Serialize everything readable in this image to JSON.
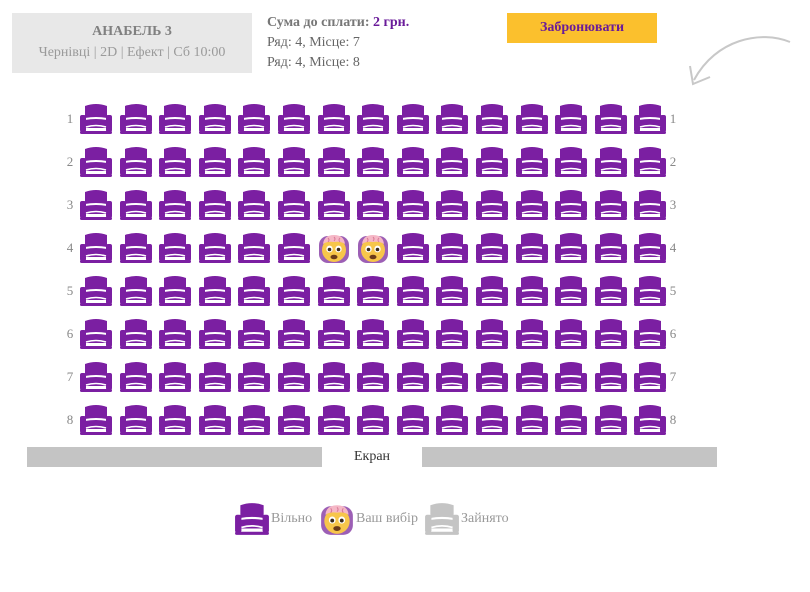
{
  "movie": {
    "title": "АНАБЕЛЬ 3",
    "details": "Чернівці | 2D | Ефект | Сб 10:00"
  },
  "order": {
    "total_label": "Сума до сплати:",
    "total_amount": "2 грн.",
    "tickets": [
      "Ряд: 4, Місце: 7",
      "Ряд: 4, Місце: 8"
    ]
  },
  "book_button": {
    "label": "Забронювати"
  },
  "hall": {
    "rows": [
      "1",
      "2",
      "3",
      "4",
      "5",
      "6",
      "7",
      "8"
    ],
    "seats_per_row": 15,
    "selected": [
      {
        "row": 4,
        "seat": 7
      },
      {
        "row": 4,
        "seat": 8
      }
    ],
    "occupied": []
  },
  "screen": {
    "label": "Екран"
  },
  "legend": {
    "free": "Вільно",
    "selected": "Ваш вибір",
    "occupied": "Зайнято"
  },
  "colors": {
    "seat_free": "#7b1fa2",
    "seat_occupied": "#c4c4c4",
    "accent": "#fbc02d",
    "selected_face": "#f7c64a",
    "selected_brain": "#f5b7c6"
  },
  "icons": {
    "seat_free": "armchair-icon",
    "seat_selected": "brain-face-icon",
    "seat_occupied": "armchair-icon"
  }
}
